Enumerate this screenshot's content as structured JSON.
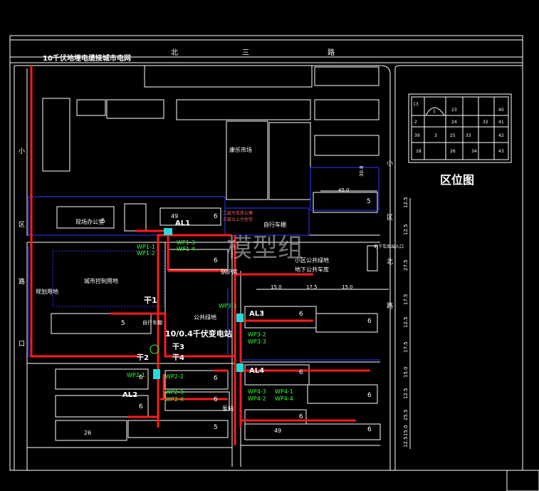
{
  "title": "10千伏地埋电缆接城市电网",
  "roads": {
    "north_road": [
      "北",
      "三",
      "路"
    ],
    "west_road": [
      "小",
      "区",
      "路",
      "口",
      "路"
    ],
    "east_road": [
      "小",
      "区",
      "北",
      "路"
    ]
  },
  "labels": {
    "market": "康乐市场",
    "office": "现场办公室",
    "bike_shed": "自行车棚",
    "bike_shed_2": "自行车棚",
    "park_green": "公共绿地",
    "transformer": "10/0.4千伏变电站",
    "reserved_land": "城市控制用地",
    "parking_reserved": "规划用地",
    "community_green": "小区公共绿地",
    "underground_parking": "地下公共车库",
    "parking_entry": "地下车库出入口",
    "pump": "泵站",
    "boiler": "锅炉房",
    "sign_1": "二层为车库公寓",
    "sign_2": "三层以上为住宅",
    "watermark": "模型组",
    "district_map": "区位图"
  },
  "panels": [
    "AL1",
    "AL2",
    "AL3",
    "AL4"
  ],
  "trunks": [
    "干1",
    "干2",
    "干3",
    "干4"
  ],
  "wp_labels": {
    "wp1": [
      "WP1-1",
      "WP1-2",
      "WP1-3",
      "WP1-4"
    ],
    "wp2": [
      "WP2-1",
      "WP2-2",
      "WP2-3",
      "WP2-4"
    ],
    "wp3": [
      "WP3-1",
      "WP3-2",
      "WP3-3"
    ],
    "wp4": [
      "WP4-1",
      "WP4-2",
      "WP4-3",
      "WP4-4"
    ]
  },
  "building_numbers": [
    "5",
    "6",
    "49",
    "6",
    "5",
    "6",
    "6",
    "6",
    "6",
    "6",
    "6",
    "6",
    "6",
    "6",
    "5",
    "6",
    "5",
    "49",
    "26"
  ],
  "dimensions": [
    "45.0",
    "15.0",
    "30.8",
    "17.5",
    "15.0",
    "12.5",
    "12.5",
    "27.5",
    "12.5",
    "17.5",
    "15.0",
    "12.5",
    "25.5",
    "15.0",
    "17.5",
    "12.5"
  ],
  "keymap_numbers": [
    "13",
    "1",
    "23",
    "40",
    "2",
    "24",
    "32",
    "41",
    "39",
    "3",
    "25",
    "33",
    "42",
    "18",
    "26",
    "34",
    "43"
  ],
  "colors": {
    "line_white": "#ffffff",
    "line_blue": "#2f3cff",
    "cable_red": "#ff1a1a",
    "label_green": "#33ff33",
    "label_yellow": "#ffff33",
    "cyan": "#22dddd"
  }
}
